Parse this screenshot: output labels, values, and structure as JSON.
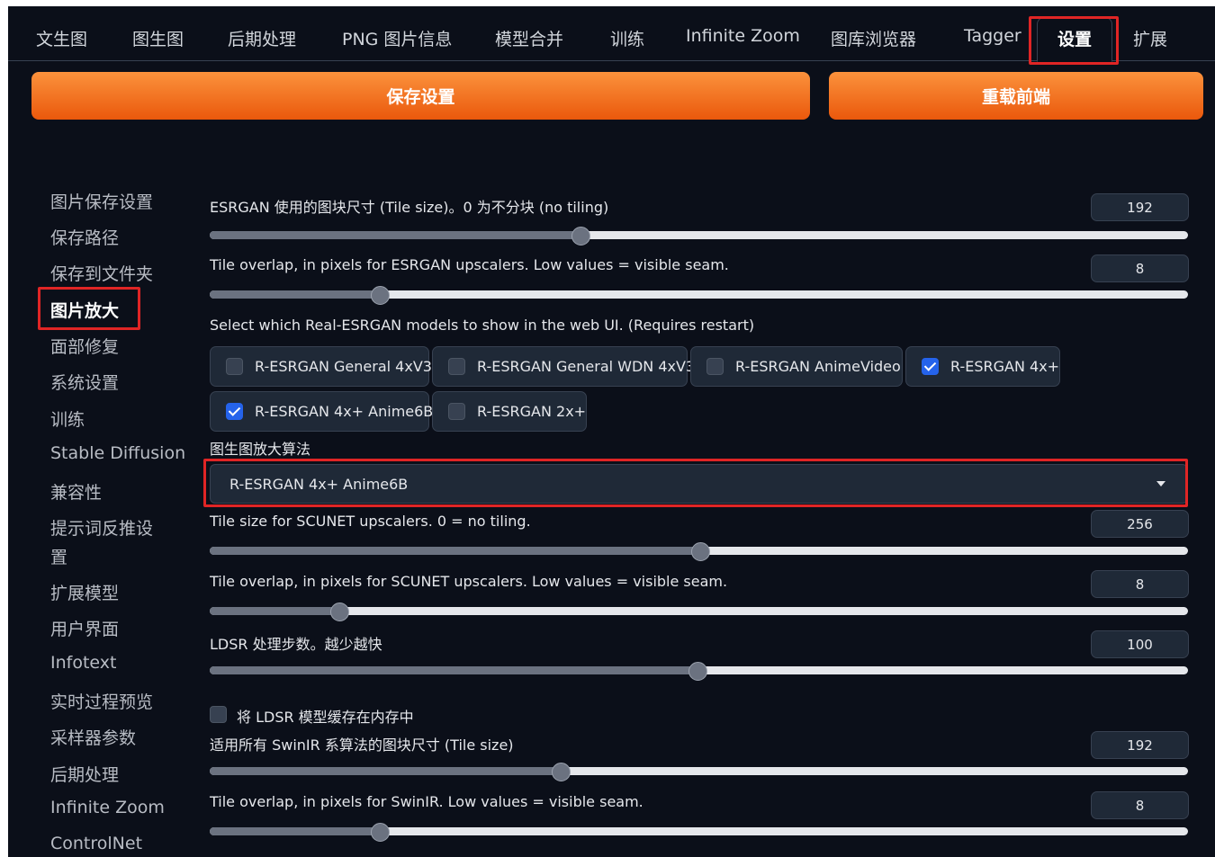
{
  "tabs": [
    {
      "label": "文生图"
    },
    {
      "label": "图生图"
    },
    {
      "label": "后期处理"
    },
    {
      "label": "PNG 图片信息"
    },
    {
      "label": "模型合并"
    },
    {
      "label": "训练"
    },
    {
      "label": "Infinite Zoom"
    },
    {
      "label": "图库浏览器"
    },
    {
      "label": "Tagger"
    },
    {
      "label": "设置"
    },
    {
      "label": "扩展"
    }
  ],
  "active_tab": "设置",
  "buttons": {
    "save": "保存设置",
    "reload": "重载前端"
  },
  "sidebar": {
    "items": [
      {
        "label": "图片保存设置"
      },
      {
        "label": "保存路径"
      },
      {
        "label": "保存到文件夹"
      },
      {
        "label": "图片放大"
      },
      {
        "label": "面部修复"
      },
      {
        "label": "系统设置"
      },
      {
        "label": "训练"
      },
      {
        "label": "Stable Diffusion"
      },
      {
        "label": "兼容性"
      },
      {
        "label": "提示词反推设"
      },
      {
        "label": "置"
      },
      {
        "label": "扩展模型"
      },
      {
        "label": "用户界面"
      },
      {
        "label": "Infotext"
      },
      {
        "label": "实时过程预览"
      },
      {
        "label": "采样器参数"
      },
      {
        "label": "后期处理"
      },
      {
        "label": "Infinite Zoom"
      },
      {
        "label": "ControlNet"
      }
    ],
    "active": "图片放大"
  },
  "settings": {
    "esrgan_tile": {
      "label": "ESRGAN 使用的图块尺寸 (Tile size)。0 为不分块 (no tiling)",
      "value": "192",
      "fraction": 0.378
    },
    "esrgan_overlap": {
      "label": "Tile overlap, in pixels for ESRGAN upscalers. Low values = visible seam.",
      "value": "8",
      "fraction": 0.173
    },
    "realesrgan_models": {
      "label": "Select which Real-ESRGAN models to show in the web UI. (Requires restart)",
      "options": [
        {
          "label": "R-ESRGAN General 4xV3",
          "checked": false
        },
        {
          "label": "R-ESRGAN General WDN 4xV3",
          "checked": false
        },
        {
          "label": "R-ESRGAN AnimeVideo",
          "checked": false
        },
        {
          "label": "R-ESRGAN 4x+",
          "checked": true
        },
        {
          "label": "R-ESRGAN 4x+ Anime6B",
          "checked": true
        },
        {
          "label": "R-ESRGAN 2x+",
          "checked": false
        }
      ]
    },
    "img2img_upscaler": {
      "label": "图生图放大算法",
      "value": "R-ESRGAN 4x+ Anime6B"
    },
    "scunet_tile": {
      "label": "Tile size for SCUNET upscalers. 0 = no tiling.",
      "value": "256",
      "fraction": 0.5
    },
    "scunet_overlap": {
      "label": "Tile overlap, in pixels for SCUNET upscalers. Low values = visible seam.",
      "value": "8",
      "fraction": 0.132
    },
    "ldsr_steps": {
      "label": "LDSR 处理步数。越少越快",
      "value": "100",
      "fraction": 0.498
    },
    "ldsr_cache": {
      "label": "将 LDSR 模型缓存在内存中",
      "checked": false
    },
    "swinir_tile": {
      "label": "适用所有 SwinIR 系算法的图块尺寸 (Tile size)",
      "value": "192",
      "fraction": 0.358
    },
    "swinir_overlap": {
      "label": "Tile overlap, in pixels for SwinIR. Low values = visible seam.",
      "value": "8",
      "fraction": 0.173
    }
  },
  "colors": {
    "accent": "#f97316",
    "highlight": "#e02525",
    "background": "#0b0f19",
    "check": "#2563eb"
  }
}
